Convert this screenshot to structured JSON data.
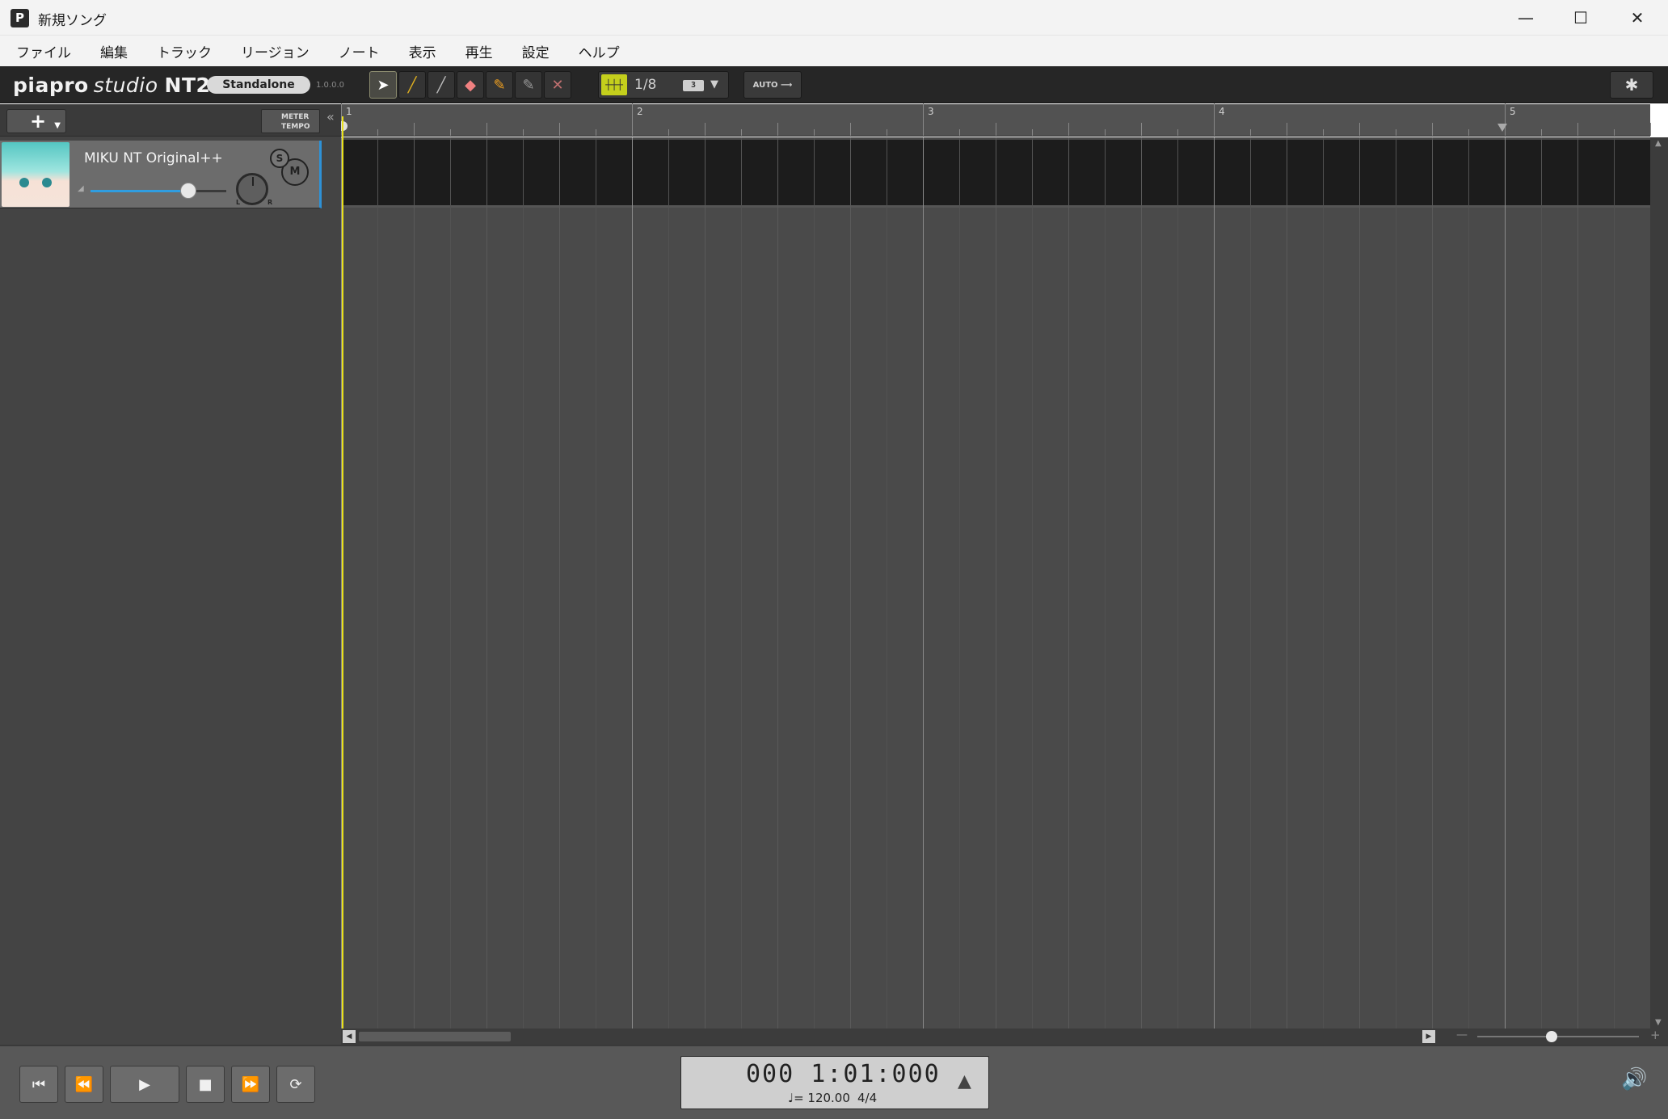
{
  "window": {
    "title": "新規ソング",
    "app_icon": "P"
  },
  "menu": [
    "ファイル",
    "編集",
    "トラック",
    "リージョン",
    "ノート",
    "表示",
    "再生",
    "設定",
    "ヘルプ"
  ],
  "toolbar": {
    "logo_main": "piapro",
    "logo_studio": "studio",
    "logo_nt": "NT2",
    "edition": "Standalone",
    "version": "1.0.0.0",
    "quantize_value": "1/8",
    "triplet_label": "3",
    "auto_label": "AUTO",
    "tools": [
      "pointer",
      "pencil",
      "line",
      "eraser",
      "vibrato",
      "pen",
      "delete"
    ]
  },
  "left_panel": {
    "add_label": "+",
    "meter_label": "METER",
    "tempo_label": "TEMPO",
    "collapse_label": "«"
  },
  "track": {
    "name": "MIKU NT Original++",
    "solo_label": "S",
    "mute_label": "M",
    "volume": 0.72,
    "pan_left": "L",
    "pan_right": "R"
  },
  "ruler": {
    "bars": [
      "1",
      "2",
      "3",
      "4",
      "5"
    ]
  },
  "transport": {
    "time": "000 1:01:000",
    "tempo": "♩= 120.00",
    "meter": "4/4"
  },
  "colors": {
    "accent_blue": "#2e91d6",
    "playhead_yellow": "#e8e01a",
    "quantize_green": "#c4cf1c"
  }
}
